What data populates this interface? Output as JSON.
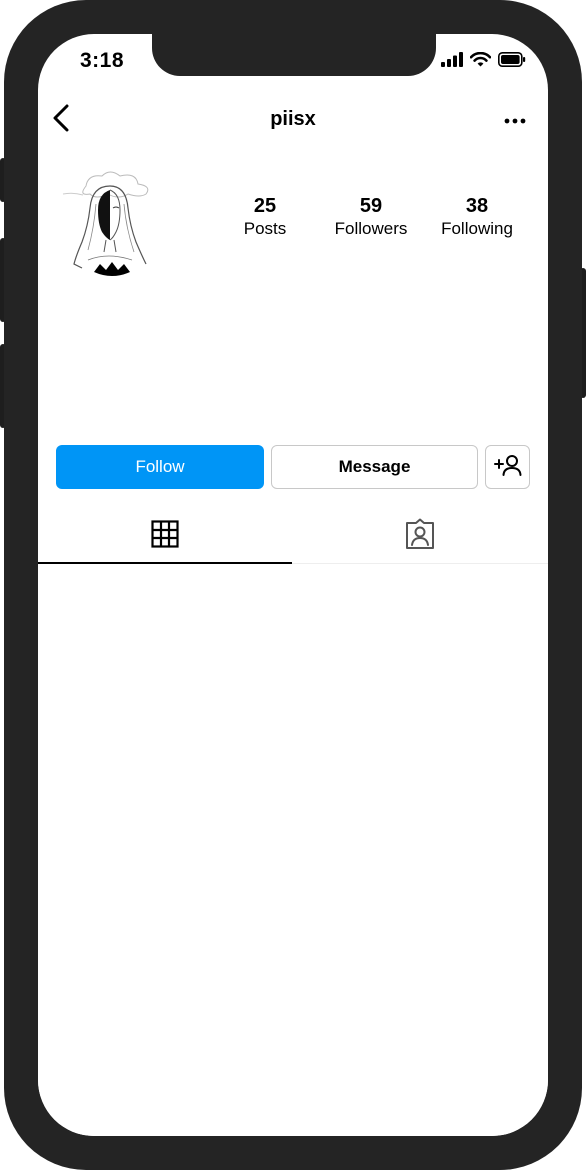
{
  "status_bar": {
    "time": "3:18",
    "icons": [
      "signal-icon",
      "wifi-icon",
      "battery-icon"
    ]
  },
  "header": {
    "username": "piisx",
    "back_icon": "chevron-left-icon",
    "more_icon": "more-horizontal-icon"
  },
  "profile": {
    "stats": [
      {
        "value": "25",
        "label": "Posts"
      },
      {
        "value": "59",
        "label": "Followers"
      },
      {
        "value": "38",
        "label": "Following"
      }
    ]
  },
  "actions": {
    "follow_label": "Follow",
    "message_label": "Message",
    "add_icon": "add-person-icon"
  },
  "tabs": [
    {
      "icon": "grid-icon",
      "active": true
    },
    {
      "icon": "tagged-person-icon",
      "active": false
    }
  ],
  "colors": {
    "accent": "#0095f6",
    "frame": "#242424"
  }
}
